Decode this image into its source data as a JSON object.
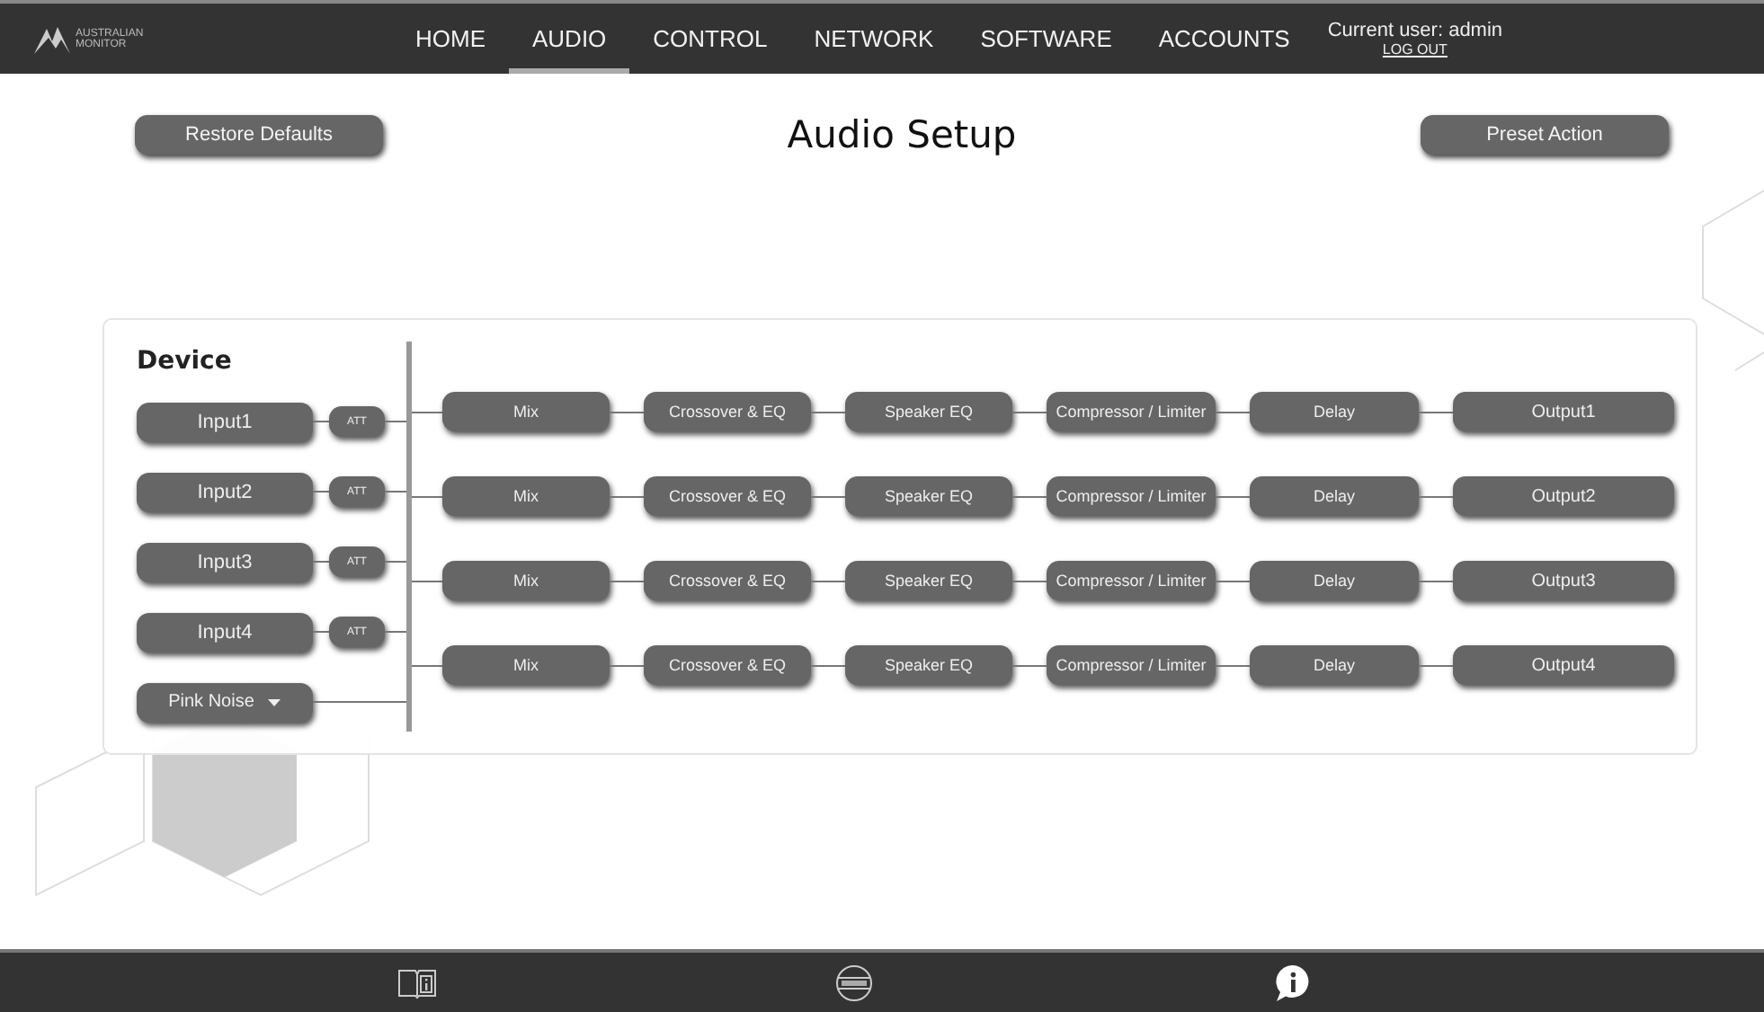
{
  "logo": {
    "line1": "AUSTRALIAN",
    "line2": "MONITOR"
  },
  "nav": [
    {
      "label": "HOME",
      "selected": false
    },
    {
      "label": "AUDIO",
      "selected": true
    },
    {
      "label": "CONTROL",
      "selected": false
    },
    {
      "label": "NETWORK",
      "selected": false
    },
    {
      "label": "SOFTWARE",
      "selected": false
    },
    {
      "label": "ACCOUNTS",
      "selected": false
    }
  ],
  "user": {
    "text": "Current user: admin",
    "logout": "LOG OUT"
  },
  "toolbar": {
    "left_button": "Restore Defaults",
    "title": "Audio Setup",
    "right_button": "Preset Action"
  },
  "device": {
    "title": "Device",
    "inputs": [
      {
        "label": "Input1",
        "att": "ATT"
      },
      {
        "label": "Input2",
        "att": "ATT"
      },
      {
        "label": "Input3",
        "att": "ATT"
      },
      {
        "label": "Input4",
        "att": "ATT"
      }
    ],
    "source": {
      "label": "Pink Noise"
    }
  },
  "channels": [
    {
      "stages": [
        "Mix",
        "Crossover & EQ",
        "Speaker EQ",
        "Compressor / Limiter",
        "Delay"
      ],
      "output": "Output1"
    },
    {
      "stages": [
        "Mix",
        "Crossover & EQ",
        "Speaker EQ",
        "Compressor / Limiter",
        "Delay"
      ],
      "output": "Output2"
    },
    {
      "stages": [
        "Mix",
        "Crossover & EQ",
        "Speaker EQ",
        "Compressor / Limiter",
        "Delay"
      ],
      "output": "Output3"
    },
    {
      "stages": [
        "Mix",
        "Crossover & EQ",
        "Speaker EQ",
        "Compressor / Limiter",
        "Delay"
      ],
      "output": "Output4"
    }
  ]
}
